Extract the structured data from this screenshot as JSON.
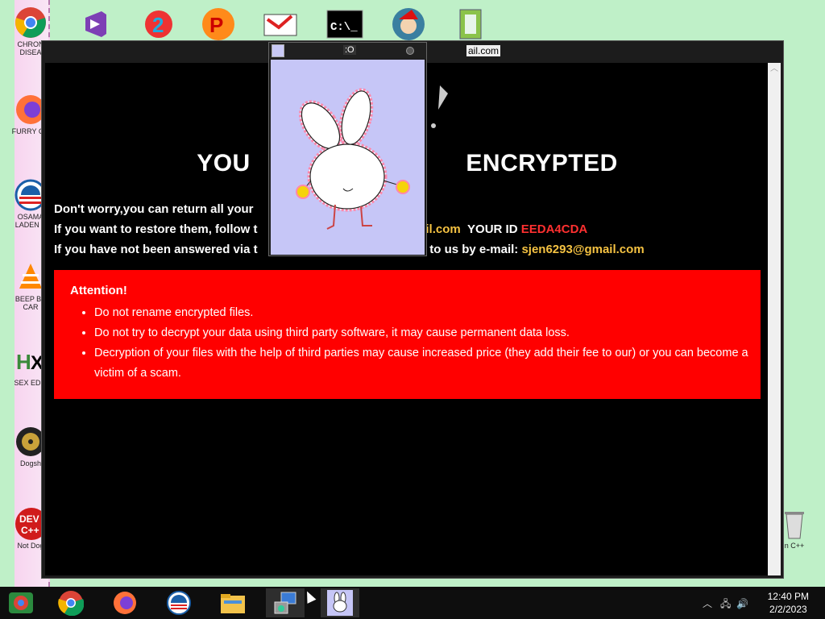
{
  "colors": {
    "desktop_bg": "#bff0c8",
    "window_bg": "#000000",
    "headline": "#ffffff",
    "email": "#f5c242",
    "id": "#ff3030",
    "attention_bg": "#ff0000",
    "popup_bg": "#c6c6f7",
    "taskbar_bg": "#0e0e0e"
  },
  "desktop": {
    "left_icons": [
      {
        "icon": "chrome-icon",
        "label": "CHRON\nDISEA"
      },
      {
        "icon": "firefox-icon",
        "label": "FURRY CO"
      },
      {
        "icon": "obama-icon",
        "label": "OSAMA\nLADEN B"
      },
      {
        "icon": "vlc-icon",
        "label": "BEEP BE\nCAR"
      },
      {
        "icon": "hxd-icon",
        "label": "SEX EDIT"
      },
      {
        "icon": "dogshit-icon",
        "label": "Dogsh"
      },
      {
        "icon": "devcpp-icon",
        "label": "Not Dog"
      }
    ],
    "right_icons": [
      {
        "icon": "recycle-bin-icon",
        "label": "n C++"
      }
    ],
    "top_icons": [
      "visual-studio-icon",
      "quiz-icon",
      "pinball-icon",
      "paint-icon",
      "cmd-icon",
      "santa-icon",
      "notepad-icon"
    ]
  },
  "window": {
    "title_tail": "ail.com"
  },
  "ransom": {
    "headline_left": "YOU",
    "headline_right": "ENCRYPTED",
    "line1": "Don't worry,you can return all your",
    "line2_left": "If you want to restore them, follow t",
    "line2_email": "gmail.com",
    "line2_id_label": "YOUR ID",
    "line2_id": "EEDA4CDA",
    "line3_left": "If you have not been answered via t",
    "line3_mid": "ite to us by e-mail:",
    "line3_email": "sjen6293@gmail.com"
  },
  "attention": {
    "title": "Attention!",
    "items": [
      "Do not rename encrypted files.",
      "Do not try to decrypt your data using third party software, it may cause permanent data loss.",
      "Decryption of your files with the help of third parties may cause increased price (they add their fee to our) or you can become a victim of a scam."
    ]
  },
  "popup": {
    "title": ":O"
  },
  "taskbar": {
    "buttons": [
      "start-icon",
      "chrome-icon",
      "firefox-icon",
      "obama-icon",
      "file-explorer-icon",
      "network-app-icon",
      "bunny-app-icon"
    ],
    "time": "12:40 PM",
    "date": "2/2/2023"
  }
}
